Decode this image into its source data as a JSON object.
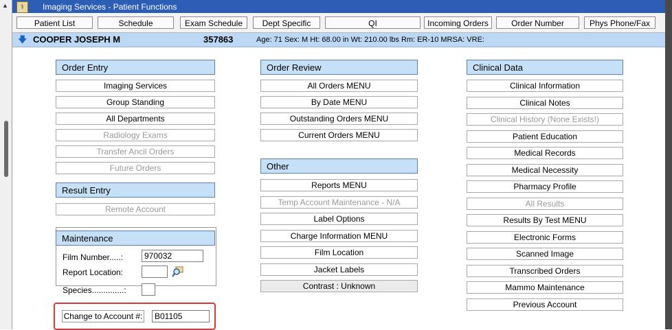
{
  "window": {
    "title": "Imaging Services - Patient Functions",
    "app_icon": "imaging-app-icon"
  },
  "nav": [
    {
      "label": "Patient List",
      "name": "nav-patient-list"
    },
    {
      "label": "Schedule",
      "name": "nav-schedule"
    },
    {
      "label": "Exam Schedule",
      "name": "nav-exam-schedule"
    },
    {
      "label": "Dept Specific",
      "name": "nav-dept-specific"
    },
    {
      "label": "QI",
      "name": "nav-qi"
    },
    {
      "label": "Incoming Orders",
      "name": "nav-incoming-orders"
    },
    {
      "label": "Order Number",
      "name": "nav-order-number"
    },
    {
      "label": "Phys Phone/Fax",
      "name": "nav-phys-phone-fax"
    }
  ],
  "patient": {
    "name": "COOPER JOSEPH M",
    "mrn": "357863",
    "info": "Age: 71  Sex: M  Ht: 68.00 in  Wt: 210.00 lbs  Rm: ER-10   MRSA:    VRE:"
  },
  "order_entry": {
    "header": "Order Entry",
    "items": [
      {
        "label": "Imaging Services",
        "enabled": true
      },
      {
        "label": "Group Standing",
        "enabled": true
      },
      {
        "label": "All Departments",
        "enabled": true
      },
      {
        "label": "Radiology Exams",
        "enabled": false
      },
      {
        "label": "Transfer Ancil Orders",
        "enabled": false
      },
      {
        "label": "Future Orders",
        "enabled": false
      }
    ]
  },
  "result_entry": {
    "header": "Result Entry",
    "items": [
      {
        "label": "Remote Account",
        "enabled": false
      }
    ]
  },
  "maintenance": {
    "header": "Maintenance",
    "film_number_label": "Film Number.....:",
    "film_number_value": "970032",
    "report_location_label": "Report Location:",
    "report_location_value": "",
    "species_label": "Species..............:",
    "species_value": ""
  },
  "change_account": {
    "label": "Change to Account #:",
    "value": "B01105"
  },
  "order_review": {
    "header": "Order Review",
    "items": [
      {
        "label": "All Orders MENU",
        "enabled": true
      },
      {
        "label": "By Date MENU",
        "enabled": true
      },
      {
        "label": "Outstanding Orders MENU",
        "enabled": true
      },
      {
        "label": "Current Orders MENU",
        "enabled": true
      }
    ]
  },
  "other": {
    "header": "Other",
    "items": [
      {
        "label": "Reports MENU",
        "enabled": true
      },
      {
        "label": "Temp Account Maintenance - N/A",
        "enabled": false
      },
      {
        "label": "Label Options",
        "enabled": true
      },
      {
        "label": "Charge Information MENU",
        "enabled": true
      },
      {
        "label": "Film Location",
        "enabled": true
      },
      {
        "label": "Jacket Labels",
        "enabled": true
      },
      {
        "label": "Contrast : Unknown",
        "enabled": true,
        "style": "gray"
      }
    ]
  },
  "clinical_data": {
    "header": "Clinical Data",
    "items": [
      {
        "label": "Clinical Information",
        "enabled": true
      },
      {
        "label": "Clinical Notes",
        "enabled": true
      },
      {
        "label": "Clinical History (None Exists!)",
        "enabled": false
      },
      {
        "label": "Patient Education",
        "enabled": true
      },
      {
        "label": "Medical Records",
        "enabled": true
      },
      {
        "label": "Medical Necessity",
        "enabled": true
      },
      {
        "label": "Pharmacy Profile",
        "enabled": true
      },
      {
        "label": "All Results",
        "enabled": false
      },
      {
        "label": "Results By Test MENU",
        "enabled": true
      },
      {
        "label": "Electronic Forms",
        "enabled": true
      },
      {
        "label": "Scanned Image",
        "enabled": true
      },
      {
        "label": "Transcribed Orders",
        "enabled": true
      },
      {
        "label": "Mammo Maintenance",
        "enabled": true
      },
      {
        "label": "Previous Account",
        "enabled": true
      }
    ]
  }
}
